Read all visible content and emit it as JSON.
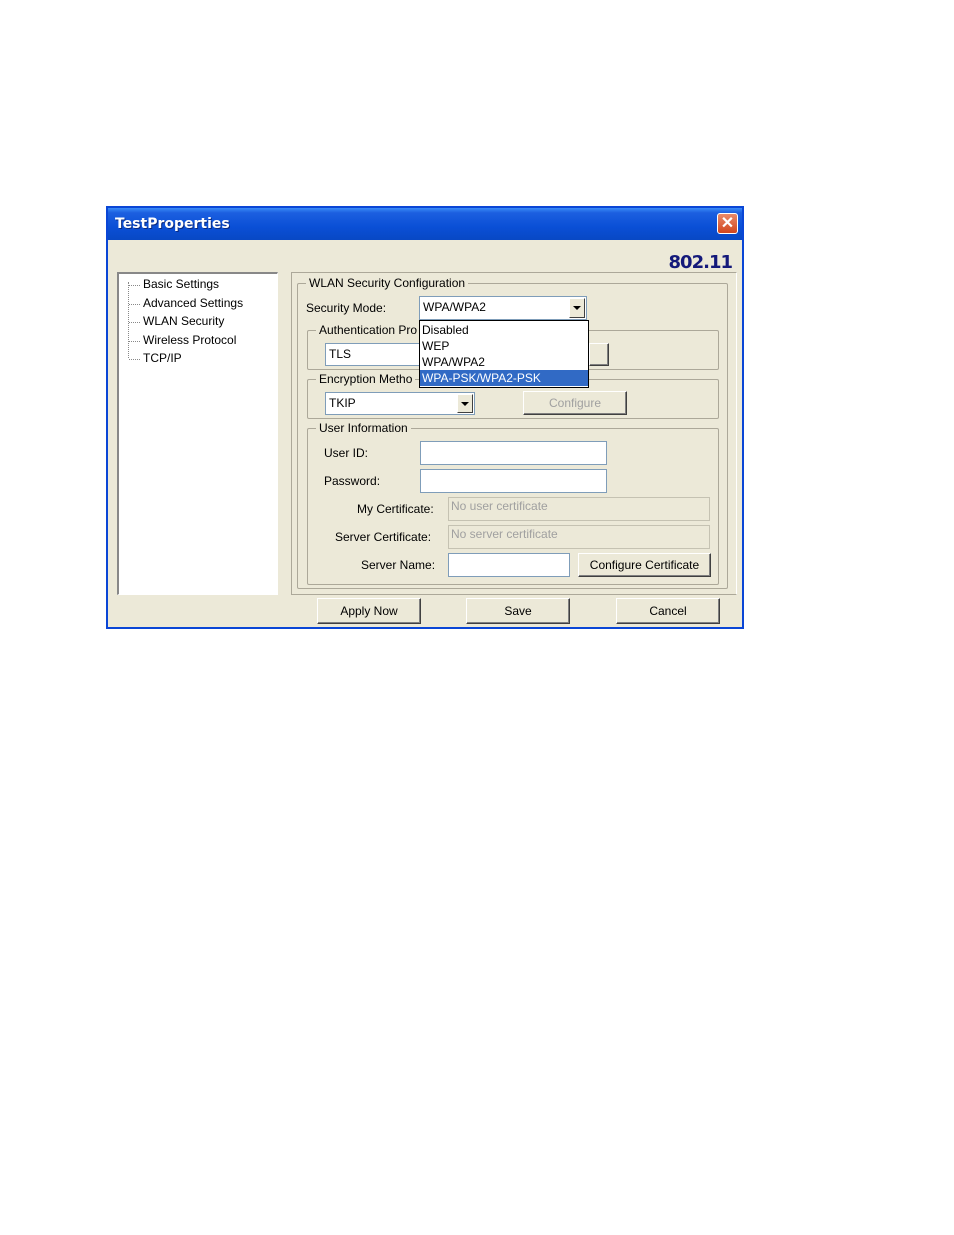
{
  "window": {
    "title": "TestProperties",
    "brand": "802.11"
  },
  "tree": {
    "items": [
      "Basic Settings",
      "Advanced Settings",
      "WLAN Security",
      "Wireless Protocol",
      "TCP/IP"
    ]
  },
  "wlan": {
    "group_label": "WLAN Security Configuration",
    "security_mode_label": "Security Mode:",
    "security_mode_value": "WPA/WPA2",
    "dropdown_options": [
      "Disabled",
      "WEP",
      "WPA/WPA2",
      "WPA-PSK/WPA2-PSK"
    ],
    "dropdown_selected": "WPA-PSK/WPA2-PSK",
    "auth_group_label": "Authentication Pro",
    "auth_value": "TLS",
    "enc_group_label": "Encryption Metho",
    "enc_value": "TKIP",
    "configure_label": "Configure"
  },
  "user": {
    "group_label": "User Information",
    "user_id_label": "User ID:",
    "user_id_value": "",
    "password_label": "Password:",
    "password_value": "",
    "my_cert_label": "My Certificate:",
    "my_cert_placeholder": "No user certificate",
    "server_cert_label": "Server Certificate:",
    "server_cert_placeholder": "No server certificate",
    "server_name_label": "Server Name:",
    "server_name_value": "",
    "configure_cert_label": "Configure Certificate"
  },
  "buttons": {
    "apply": "Apply Now",
    "save": "Save",
    "cancel": "Cancel"
  },
  "icons": {
    "close": "close-icon"
  },
  "colors": {
    "titlebar": "#0a4fd6",
    "selection": "#316ac5",
    "brand": "#14197a"
  }
}
